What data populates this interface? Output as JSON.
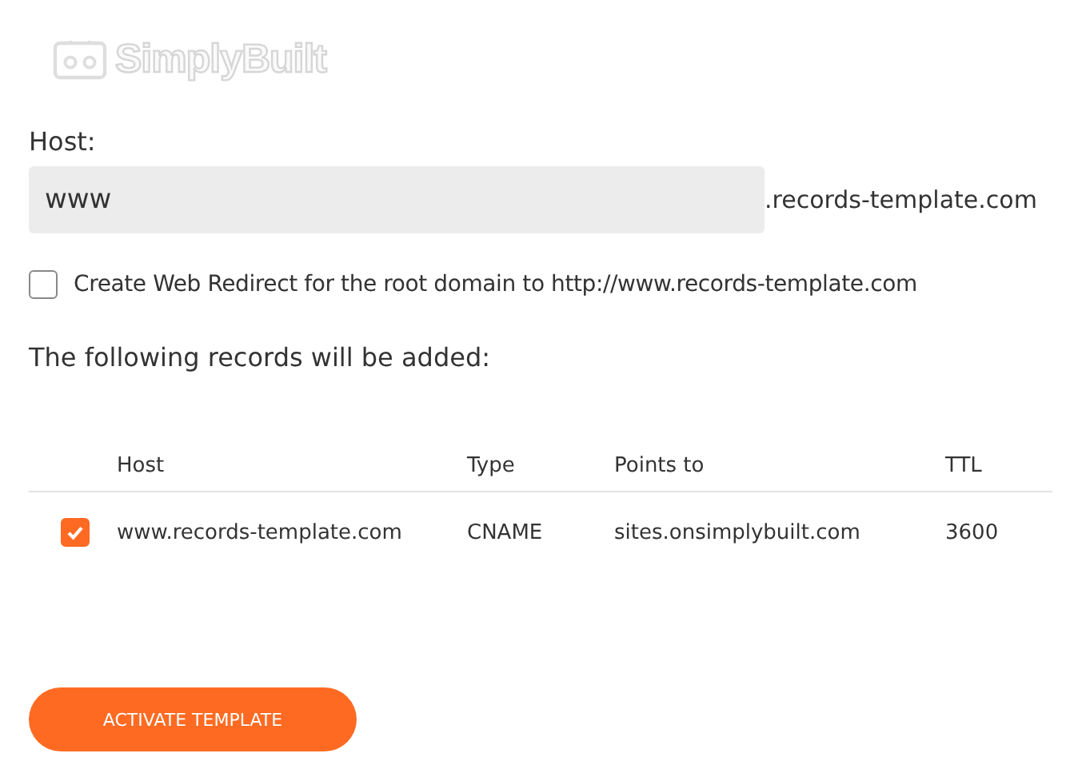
{
  "logo": {
    "text": "SimplyBuilt"
  },
  "host": {
    "label": "Host:",
    "value": "www",
    "suffix": ".records-template.com"
  },
  "redirect": {
    "label": "Create Web Redirect for the root domain to http://www.records-template.com",
    "checked": false
  },
  "heading": "The following records will be added:",
  "table": {
    "columns": [
      "Host",
      "Type",
      "Points to",
      "TTL"
    ],
    "rows": [
      {
        "checked": true,
        "cells": [
          "www.records-template.com",
          "CNAME",
          "sites.onsimplybuilt.com",
          "3600"
        ]
      }
    ]
  },
  "button": "ACTIVATE TEMPLATE"
}
